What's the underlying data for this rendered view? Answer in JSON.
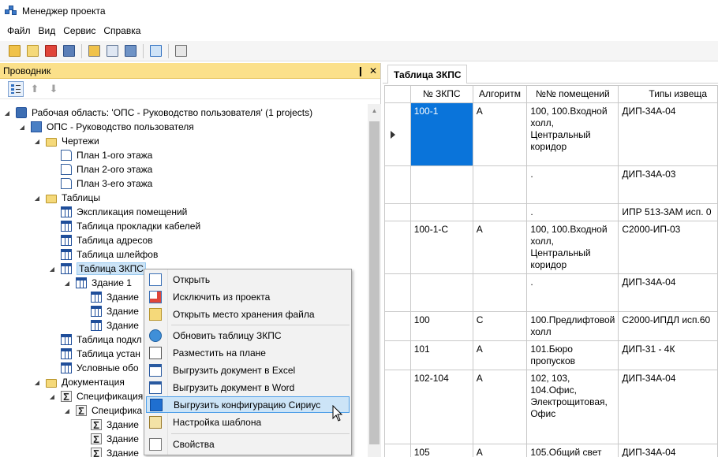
{
  "window": {
    "title": "Менеджер проекта"
  },
  "menu": [
    "Файл",
    "Вид",
    "Сервис",
    "Справка"
  ],
  "explorer": {
    "title": "Проводник",
    "pin_glyph": "❙",
    "close_glyph": "✕",
    "tree": [
      {
        "label": "Рабочая область: 'ОПС - Руководство пользователя' (1 projects)",
        "icon": "workspace-icon",
        "expanded": true
      },
      {
        "label": "ОПС - Руководство пользователя",
        "icon": "project-icon",
        "expanded": true
      },
      {
        "label": "Чертежи",
        "icon": "folder-icon",
        "expanded": true
      },
      {
        "label": "План 1-ого этажа",
        "icon": "plan-icon"
      },
      {
        "label": "План 2-ого этажа",
        "icon": "plan-icon"
      },
      {
        "label": "План 3-его этажа",
        "icon": "plan-icon"
      },
      {
        "label": "Таблицы",
        "icon": "folder-icon",
        "expanded": true
      },
      {
        "label": "Экспликация помещений",
        "icon": "table-icon"
      },
      {
        "label": "Таблица прокладки кабелей",
        "icon": "table-icon"
      },
      {
        "label": "Таблица адресов",
        "icon": "table-icon"
      },
      {
        "label": "Таблица шлейфов",
        "icon": "table-icon"
      },
      {
        "label": "Таблица ЗКПС",
        "icon": "table-icon",
        "expanded": true,
        "selected": true
      },
      {
        "label": "Здание 1",
        "icon": "table-icon",
        "expanded": true
      },
      {
        "label": "Здание",
        "icon": "table-icon"
      },
      {
        "label": "Здание",
        "icon": "table-icon"
      },
      {
        "label": "Здание",
        "icon": "table-icon"
      },
      {
        "label": "Таблица подкл",
        "icon": "table-icon"
      },
      {
        "label": "Таблица устан",
        "icon": "table-icon"
      },
      {
        "label": "Условные обо",
        "icon": "table-icon"
      },
      {
        "label": "Документация",
        "icon": "folder-icon",
        "expanded": true
      },
      {
        "label": "Спецификация",
        "icon": "sigma-icon",
        "expanded": true
      },
      {
        "label": "Специфика",
        "icon": "sigma-icon",
        "expanded": true
      },
      {
        "label": "Здание",
        "icon": "sigma-icon"
      },
      {
        "label": "Здание",
        "icon": "sigma-icon"
      },
      {
        "label": "Здание",
        "icon": "sigma-icon"
      }
    ]
  },
  "context_menu": {
    "items": [
      {
        "label": "Открыть",
        "icon": "open-icon"
      },
      {
        "label": "Исключить из проекта",
        "icon": "exclude-icon"
      },
      {
        "label": "Открыть место хранения файла",
        "icon": "folder-search-icon"
      },
      {
        "label": "Обновить таблицу ЗКПС",
        "icon": "refresh-icon"
      },
      {
        "label": "Разместить на плане",
        "icon": "place-icon"
      },
      {
        "label": "Выгрузить документ в Excel",
        "icon": "excel-export-icon"
      },
      {
        "label": "Выгрузить документ в Word",
        "icon": "word-export-icon"
      },
      {
        "label": "Выгрузить конфигурацию Сириус",
        "icon": "sirius-export-icon",
        "hover": true
      },
      {
        "label": "Настройка шаблона",
        "icon": "template-settings-icon"
      },
      {
        "label": "Свойства",
        "icon": "properties-icon"
      }
    ]
  },
  "document": {
    "tab_label": "Таблица ЗКПС",
    "columns": [
      "№ ЗКПС",
      "Алгоритм",
      "№№ помещений",
      "Типы извеща"
    ],
    "rows": [
      {
        "zkps": "100-1",
        "algo": "А",
        "rooms": "100, 100.Входной холл, Центральный коридор",
        "types": "ДИП-34А-04",
        "selected": true,
        "current": true
      },
      {
        "zkps": "",
        "algo": "",
        "rooms": ".",
        "types": "ДИП-34А-03"
      },
      {
        "zkps": "",
        "algo": "",
        "rooms": ".",
        "types": "ИПР 513-3АМ исп. 0"
      },
      {
        "zkps": "100-1-С",
        "algo": "А",
        "rooms": "100, 100.Входной холл, Центральный коридор",
        "types": "С2000-ИП-03"
      },
      {
        "zkps": "",
        "algo": "",
        "rooms": ".",
        "types": "ДИП-34А-04"
      },
      {
        "zkps": "100",
        "algo": "С",
        "rooms": "100.Предлифтовой холл",
        "types": "С2000-ИПДЛ исп.60"
      },
      {
        "zkps": "101",
        "algo": "А",
        "rooms": "101.Бюро пропусков",
        "types": "ДИП-31 - 4К"
      },
      {
        "zkps": "102-104",
        "algo": "А",
        "rooms": "102, 103, 104.Офис, Электрощитовая, Офис",
        "types": "ДИП-34А-04"
      },
      {
        "zkps": "105",
        "algo": "А",
        "rooms": "105.Общий свет",
        "types": "ДИП-34А-04"
      }
    ]
  }
}
